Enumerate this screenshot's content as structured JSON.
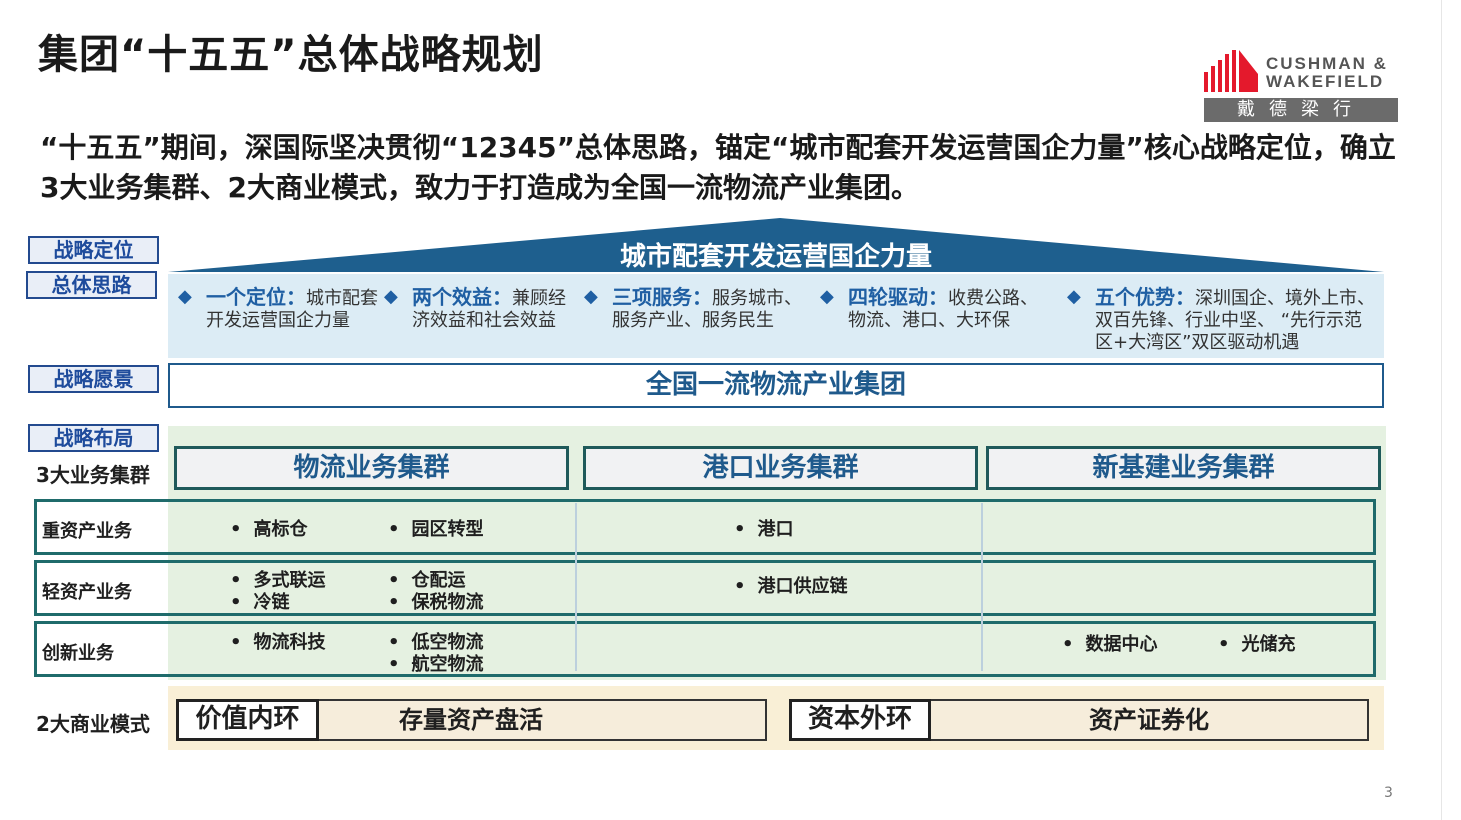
{
  "title": "集团“十五五”总体战略规划",
  "logo": {
    "line1": "CUSHMAN &",
    "line2": "WAKEFIELD",
    "cn": "戴德梁行",
    "color_red": "#e4192c"
  },
  "intro": "“十五五”期间，深国际坚决贯彻“12345”总体思路，锚定“城市配套开发运营国企力量”核心战略定位，确立3大业务集群、2大商业模式，致力于打造成为全国一流物流产业集团。",
  "labels": {
    "positioning": "战略定位",
    "thinking": "总体思路",
    "vision": "战略愿景",
    "layout": "战略布局",
    "clusters": "3大业务集群",
    "models": "2大商业模式"
  },
  "roof": "城市配套开发运营国企力量",
  "pillars": [
    {
      "head": "一个定位：",
      "text": "城市配套开发运营国企力量"
    },
    {
      "head": "两个效益：",
      "text": "兼顾经济效益和社会效益"
    },
    {
      "head": "三项服务：",
      "text": "服务城市、服务产业、服务民生"
    },
    {
      "head": "四轮驱动：",
      "text": "收费公路、物流、港口、大环保"
    },
    {
      "head": "五个优势：",
      "text": "深圳国企、境外上市、双百先锋、行业中坚、 “先行示范区+大湾区”双区驱动机遇"
    }
  ],
  "vision": "全国一流物流产业集团",
  "clusters": [
    "物流业务集群",
    "港口业务集群",
    "新基建业务集群"
  ],
  "rows": [
    {
      "label": "重资产业务",
      "logistics": [
        "高标仓",
        "园区转型"
      ],
      "port": [
        "港口"
      ],
      "newinfra": []
    },
    {
      "label": "轻资产业务",
      "logistics": [
        "多式联运",
        "仓配运",
        "冷链",
        "保税物流"
      ],
      "port": [
        "港口供应链"
      ],
      "newinfra": []
    },
    {
      "label": "创新业务",
      "logistics": [
        "物流科技",
        "低空物流",
        "航空物流"
      ],
      "port": [],
      "newinfra": [
        "数据中心",
        "光储充"
      ]
    }
  ],
  "models": [
    {
      "tag": "价值内环",
      "text": "存量资产盘活"
    },
    {
      "tag": "资本外环",
      "text": "资产证券化"
    }
  ],
  "page_number": "3",
  "colors": {
    "primary_blue": "#1f5a8c",
    "roof_blue": "#1e5f8e",
    "teal_border": "#1f6b6b",
    "green_bg": "#e5f1e1",
    "cream_bg": "#f9efd6"
  }
}
